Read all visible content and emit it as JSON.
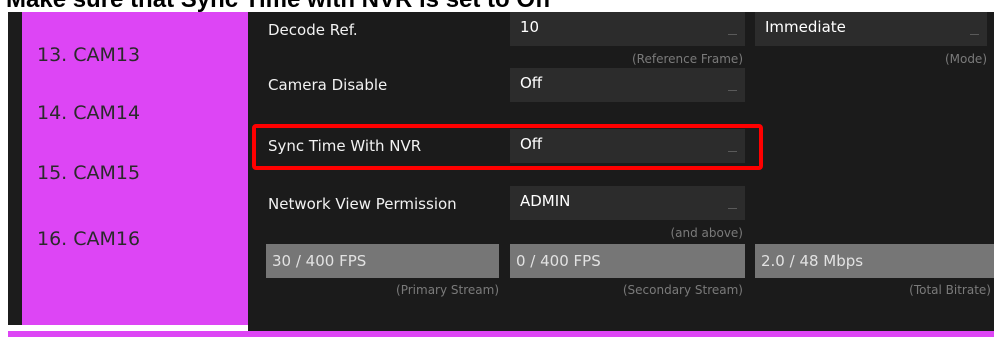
{
  "caption": "Make sure that Sync Time with NVR is set to Off",
  "sidebar": {
    "cameras": [
      "13. CAM13",
      "14. CAM14",
      "15. CAM15",
      "16. CAM16"
    ]
  },
  "settings": {
    "decode_ref": {
      "label": "Decode Ref.",
      "value": "10",
      "hint": "(Reference Frame)"
    },
    "decode_mode": {
      "value": "Immediate",
      "hint": "(Mode)"
    },
    "camera_disable": {
      "label": "Camera Disable",
      "value": "Off"
    },
    "sync_time": {
      "label": "Sync Time With NVR",
      "value": "Off"
    },
    "network_view": {
      "label": "Network View Permission",
      "value": "ADMIN",
      "hint": "(and above)"
    }
  },
  "stats": {
    "primary": {
      "value": "30 / 400 FPS",
      "hint": "(Primary Stream)"
    },
    "secondary": {
      "value": "0 / 400 FPS",
      "hint": "(Secondary Stream)"
    },
    "bitrate": {
      "value": "2.0 / 48 Mbps",
      "hint": "(Total Bitrate)"
    }
  },
  "colors": {
    "sidebar": "#dd45f5",
    "panel": "#1b1b1b",
    "highlight": "#ff0000"
  }
}
